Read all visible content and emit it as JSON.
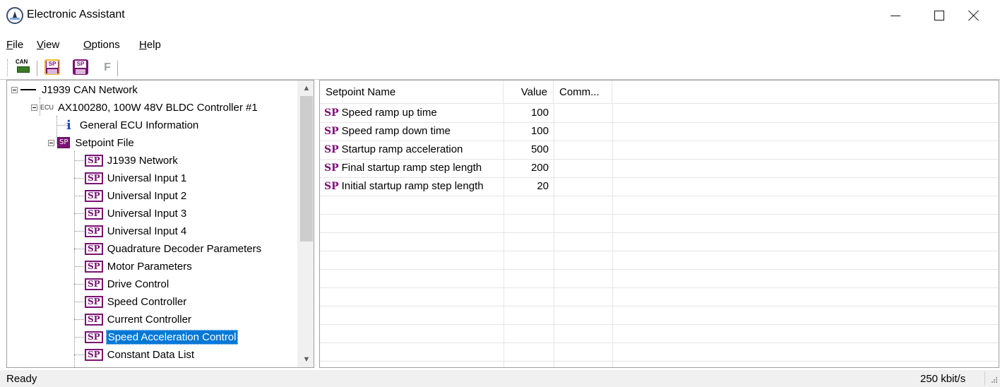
{
  "window": {
    "title": "Electronic Assistant"
  },
  "menu": {
    "items": [
      {
        "label": "File",
        "mnemonic": "F",
        "rest": "ile"
      },
      {
        "label": "View",
        "mnemonic": "V",
        "rest": "iew"
      },
      {
        "label": "Options",
        "mnemonic": "O",
        "rest": "ptions"
      },
      {
        "label": "Help",
        "mnemonic": "H",
        "rest": "elp"
      }
    ]
  },
  "toolbar": {
    "can_icon_text": "CAN",
    "sp_icon_text": "SP",
    "f_label": "F"
  },
  "tree": {
    "network": "J1939 CAN Network",
    "ecu_prefix": "ECU",
    "ecu": "AX100280, 100W 48V BLDC Controller #1",
    "info_glyph": "i",
    "general_info": "General ECU Information",
    "setpoint_file": "Setpoint File",
    "sp_glyph": "SP",
    "items": [
      {
        "label": "J1939 Network"
      },
      {
        "label": "Universal Input 1"
      },
      {
        "label": "Universal Input 2"
      },
      {
        "label": "Universal Input 3"
      },
      {
        "label": "Universal Input 4"
      },
      {
        "label": "Quadrature Decoder Parameters"
      },
      {
        "label": "Motor Parameters"
      },
      {
        "label": "Drive Control"
      },
      {
        "label": "Speed Controller"
      },
      {
        "label": "Current Controller"
      },
      {
        "label": "Speed Acceleration Control",
        "selected": true
      },
      {
        "label": "Constant Data List"
      }
    ]
  },
  "list": {
    "columns": {
      "name": "Setpoint Name",
      "value": "Value",
      "comment": "Comm..."
    },
    "sp_glyph": "SP",
    "rows": [
      {
        "name": "Speed ramp up time",
        "value": "100"
      },
      {
        "name": "Speed ramp down time",
        "value": "100"
      },
      {
        "name": "Startup ramp acceleration",
        "value": "500"
      },
      {
        "name": "Final startup ramp step length",
        "value": "200"
      },
      {
        "name": "Initial startup ramp step length",
        "value": "20"
      }
    ]
  },
  "status": {
    "left": "Ready",
    "right": "250 kbit/s"
  },
  "colors": {
    "selection": "#0078d7",
    "setpoint_purple": "#7a1275",
    "info_blue": "#1a4fc4"
  }
}
